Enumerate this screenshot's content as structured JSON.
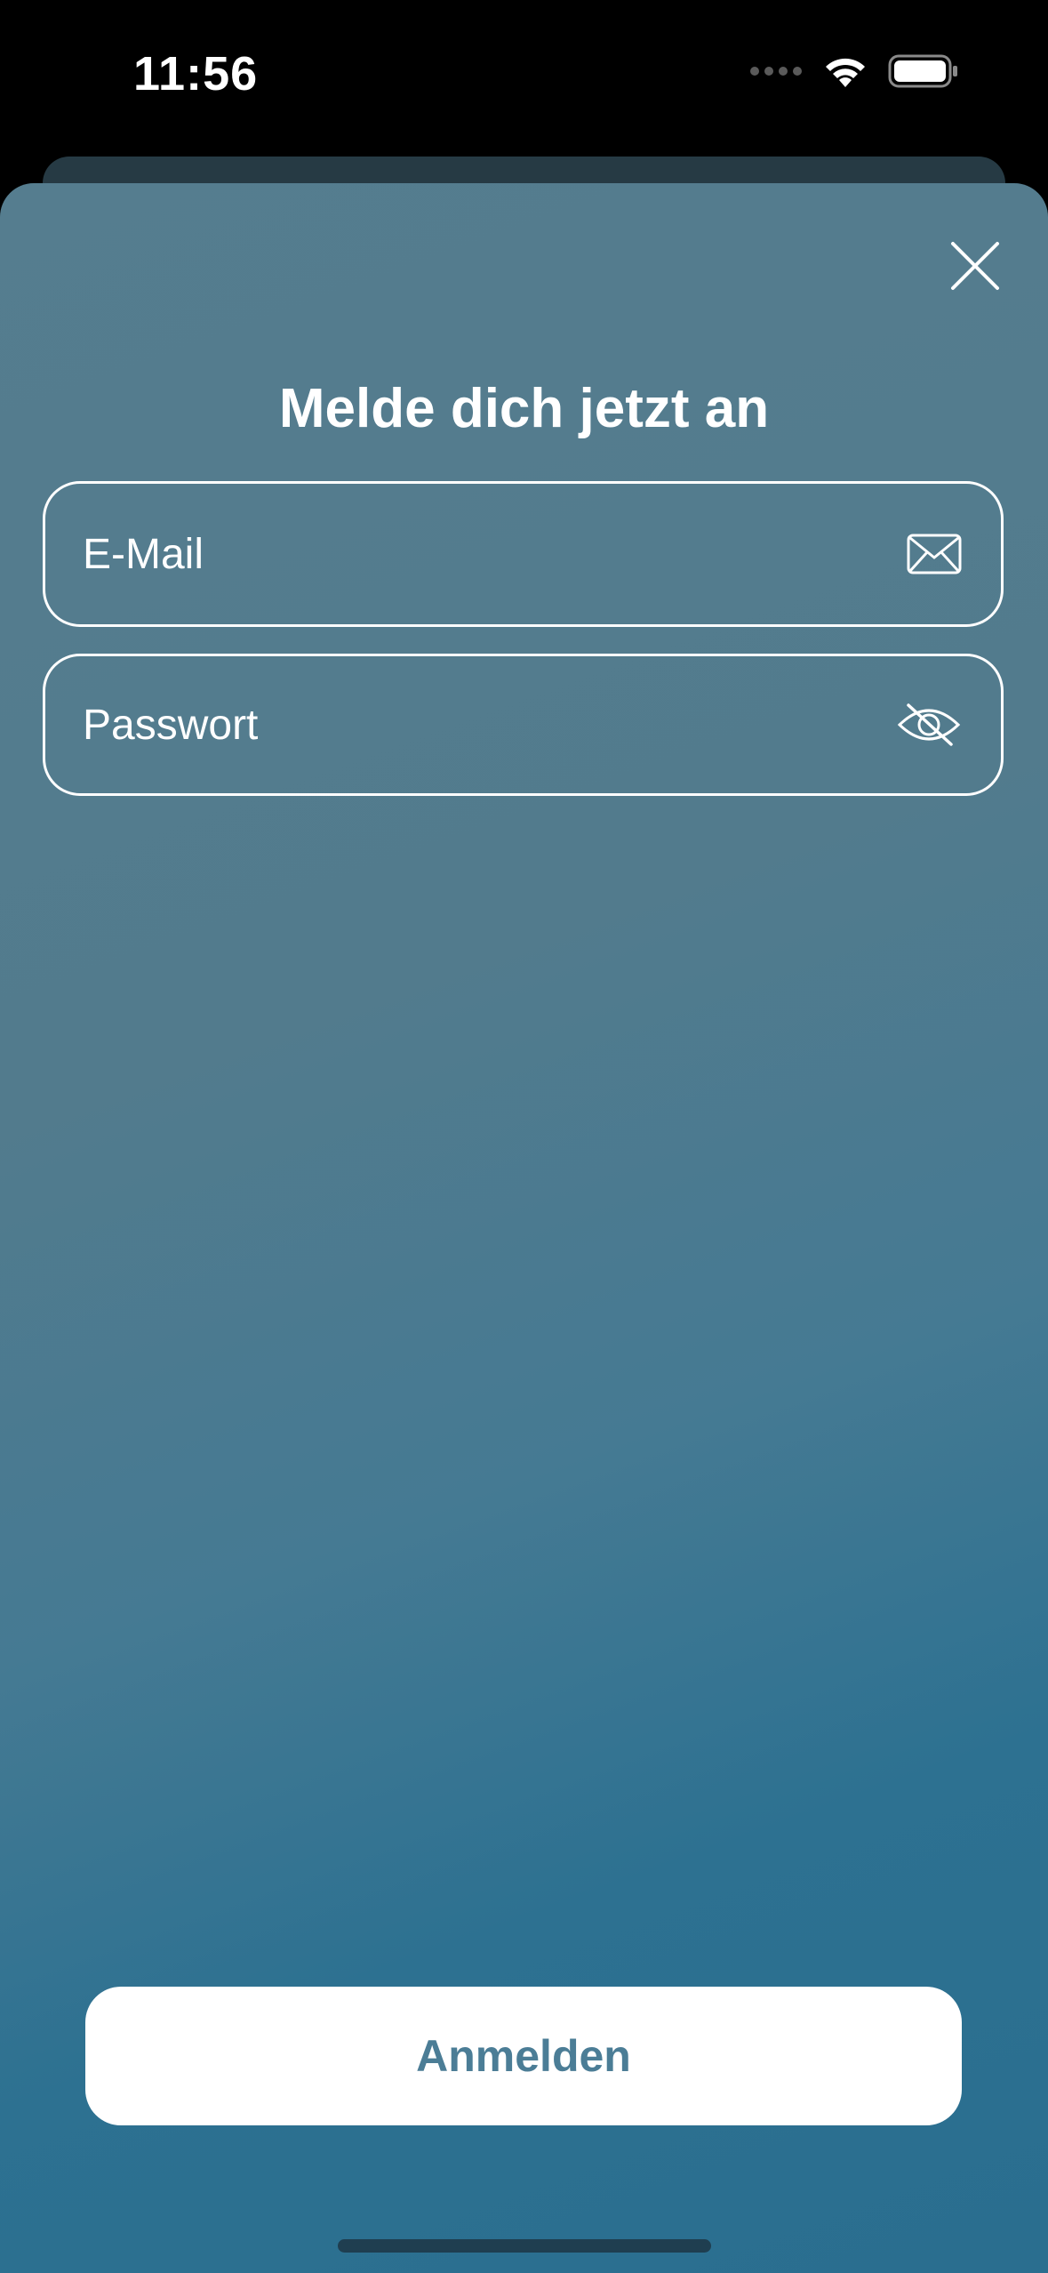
{
  "status_bar": {
    "time": "11:56",
    "icons": [
      "signal-dots-icon",
      "wifi-icon",
      "battery-icon"
    ]
  },
  "sheet": {
    "title": "Melde dich jetzt an",
    "close_icon": "close-icon"
  },
  "form": {
    "email": {
      "placeholder": "E-Mail",
      "value": "",
      "icon": "envelope-icon"
    },
    "password": {
      "placeholder": "Passwort",
      "value": "",
      "icon": "eye-slash-icon"
    }
  },
  "actions": {
    "login_label": "Anmelden"
  },
  "colors": {
    "background": "#000000",
    "sheet_top": "#557d8f",
    "sheet_bottom": "#2a6e8f",
    "button_text": "#4b7d96",
    "white": "#ffffff"
  }
}
